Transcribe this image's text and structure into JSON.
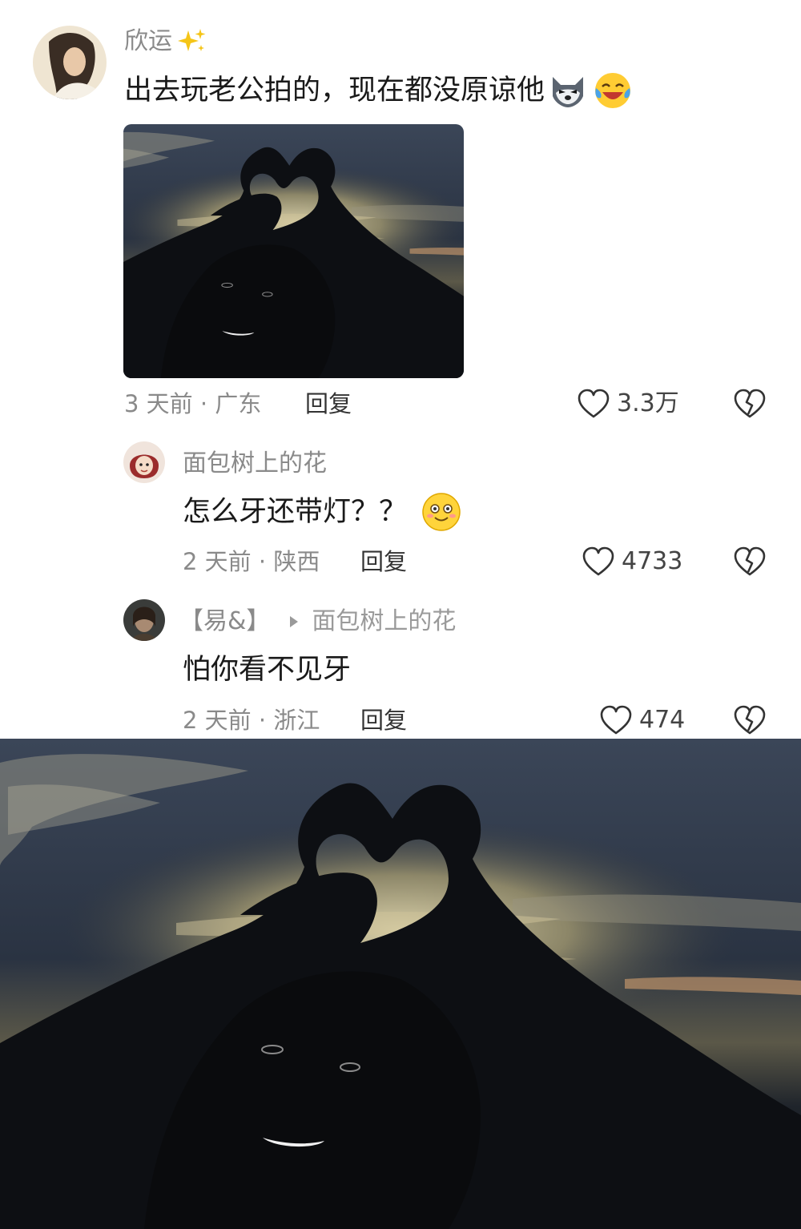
{
  "comments": [
    {
      "username": "欣运",
      "text": "出去玩老公拍的，现在都没原谅他",
      "time_location": "3 天前 · 广东",
      "reply_label": "回复",
      "likes": "3.3万"
    },
    {
      "username": "面包树上的花",
      "text": "怎么牙还带灯？？",
      "time_location": "2 天前 · 陕西",
      "reply_label": "回复",
      "likes": "4733"
    },
    {
      "username": "【易&】",
      "reply_to": "面包树上的花",
      "text": "怕你看不见牙",
      "time_location": "2 天前 · 浙江",
      "reply_label": "回复",
      "likes": "474"
    }
  ],
  "icons": {
    "sparkle": "sparkle-icon",
    "wolf": "wolf-emoji-icon",
    "crying_laughing": "crying-laughing-emoji-icon",
    "smile": "smile-emoji-icon",
    "like": "heart-icon",
    "dislike": "broken-heart-icon",
    "arrow": "play-arrow-icon"
  },
  "colors": {
    "text_primary": "#1a1a1a",
    "text_secondary": "#8a8a8a",
    "photo_sky": "#1e2530"
  }
}
